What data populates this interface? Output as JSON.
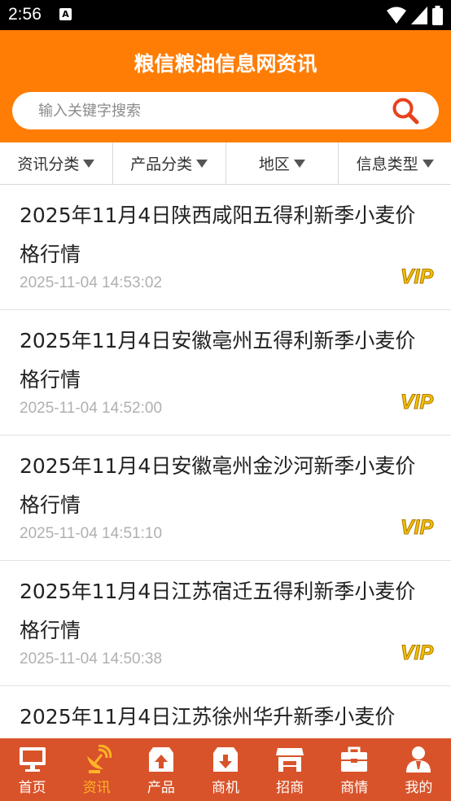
{
  "status_bar": {
    "time": "2:56",
    "notif_icon": "A"
  },
  "header": {
    "title": "粮信粮油信息网资讯"
  },
  "search": {
    "placeholder": "输入关键字搜索"
  },
  "filters": [
    {
      "label": "资讯分类"
    },
    {
      "label": "产品分类"
    },
    {
      "label": "地区"
    },
    {
      "label": "信息类型"
    }
  ],
  "news": [
    {
      "title": "2025年11月4日陕西咸阳五得利新季小麦价格行情",
      "date": "2025-11-04 14:53:02",
      "badge": "VIP"
    },
    {
      "title": "2025年11月4日安徽亳州五得利新季小麦价格行情",
      "date": "2025-11-04 14:52:00",
      "badge": "VIP"
    },
    {
      "title": "2025年11月4日安徽亳州金沙河新季小麦价格行情",
      "date": "2025-11-04 14:51:10",
      "badge": "VIP"
    },
    {
      "title": "2025年11月4日江苏宿迁五得利新季小麦价格行情",
      "date": "2025-11-04 14:50:38",
      "badge": "VIP"
    },
    {
      "title": "2025年11月4日江苏徐州华升新季小麦价",
      "date": "",
      "badge": ""
    }
  ],
  "tabs": [
    {
      "label": "首页",
      "icon": "monitor-icon"
    },
    {
      "label": "资讯",
      "icon": "satellite-icon",
      "active": true
    },
    {
      "label": "产品",
      "icon": "box-upload-icon"
    },
    {
      "label": "商机",
      "icon": "box-download-icon"
    },
    {
      "label": "招商",
      "icon": "store-icon"
    },
    {
      "label": "商情",
      "icon": "briefcase-icon"
    },
    {
      "label": "我的",
      "icon": "user-icon"
    }
  ],
  "colors": {
    "primary": "#ff7d05",
    "tab_bar": "#d9532a",
    "tab_active": "#ffb526",
    "vip": "#f0b400"
  }
}
